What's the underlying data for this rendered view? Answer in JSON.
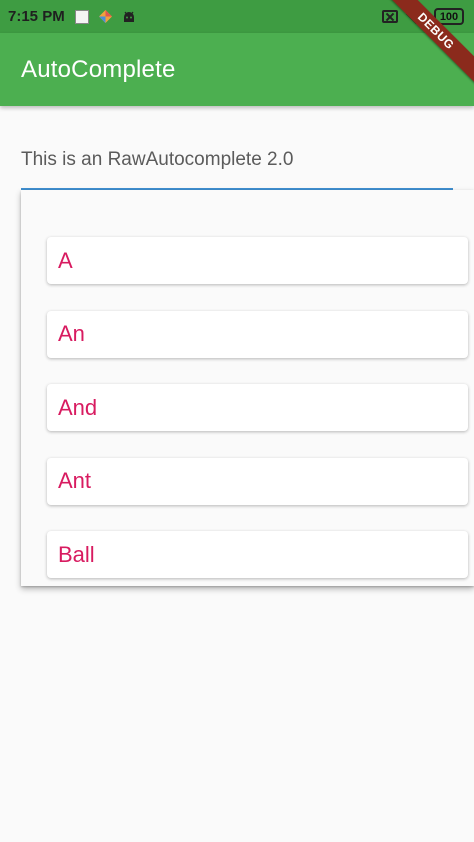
{
  "status_bar": {
    "time": "7:15 PM",
    "battery": "100",
    "icons": [
      "document-icon",
      "kite-icon",
      "android-icon",
      "no-sim-icon",
      "wifi-icon",
      "battery-icon"
    ]
  },
  "app_bar": {
    "title": "AutoComplete"
  },
  "debug_banner": {
    "label": "DEBUG"
  },
  "text_field": {
    "value": "This is an RawAutocomplete 2.0"
  },
  "options": [
    {
      "label": "A"
    },
    {
      "label": "An"
    },
    {
      "label": "And"
    },
    {
      "label": "Ant"
    },
    {
      "label": "Ball"
    }
  ],
  "colors": {
    "app_bar": "#4caf50",
    "status_bar": "#3e9c42",
    "option_text": "#d81b60",
    "field_underline": "#3f8fd0",
    "debug_ribbon": "#8b2a1c"
  }
}
